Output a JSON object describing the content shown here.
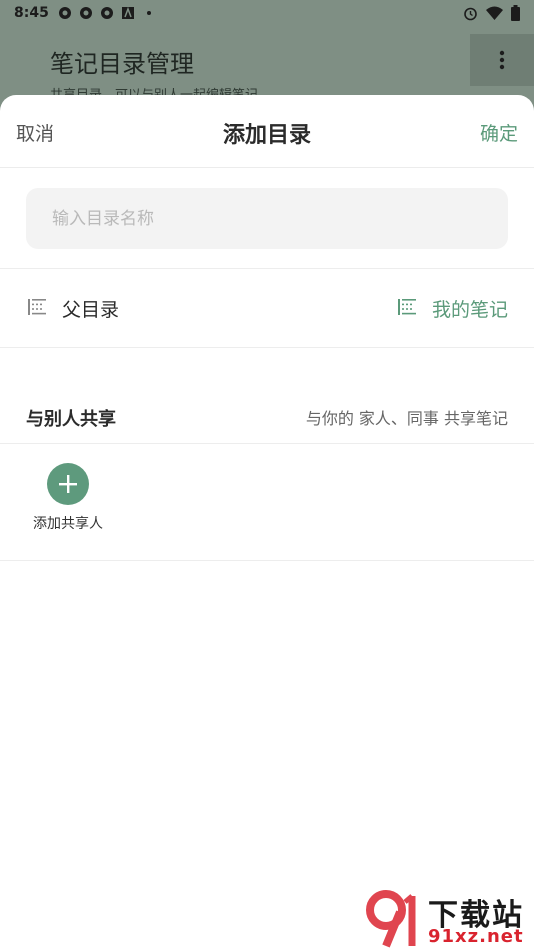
{
  "status_bar": {
    "time": "8:45"
  },
  "background_page": {
    "title": "笔记目录管理",
    "subtitle": "共享目录，可以与别人一起编辑笔记"
  },
  "sheet": {
    "cancel_label": "取消",
    "title": "添加目录",
    "confirm_label": "确定",
    "name_input": {
      "value": "",
      "placeholder": "输入目录名称"
    },
    "parent": {
      "label": "父目录",
      "value": "我的笔记"
    },
    "share": {
      "title": "与别人共享",
      "description": "与你的 家人、同事 共享笔记",
      "add_label": "添加共享人"
    }
  },
  "watermark": {
    "line1": "下载站",
    "line2": "91xz.net"
  },
  "colors": {
    "accent": "#5b9a7a",
    "overlay": "#7f8f84"
  },
  "icons": {
    "status_left": [
      "notification-icon",
      "notification-icon",
      "notification-icon",
      "font-icon",
      "dot-icon"
    ],
    "status_right": [
      "alarm-icon",
      "wifi-icon",
      "battery-icon"
    ],
    "more": "more-vertical-icon",
    "parent_row": "list-icon",
    "parent_value": "list-icon",
    "add_sharer": "plus-icon"
  }
}
